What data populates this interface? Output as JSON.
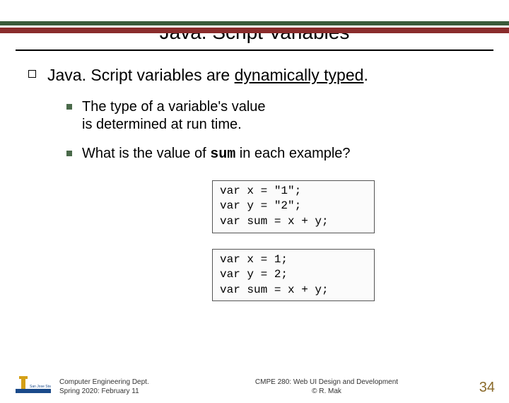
{
  "title": "Java. Script Variables",
  "main_point_pre": "Java. Script variables are ",
  "main_point_underlined": "dynamically typed",
  "main_point_post": ".",
  "sub1_line1": "The type of a variable's value",
  "sub1_line2": "is determined at run time.",
  "sub2_pre": "What is the value of ",
  "sub2_mono": "sum",
  "sub2_post": " in each example?",
  "code1": "var x = \"1\";\nvar y = \"2\";\nvar sum = x + y;",
  "code2": "var x = 1;\nvar y = 2;\nvar sum = x + y;",
  "footer_left_line1": "Computer Engineering Dept.",
  "footer_left_line2": "Spring 2020: February 11",
  "footer_center_line1": "CMPE 280: Web UI Design and Development",
  "footer_center_line2": "© R. Mak",
  "page_number": "34"
}
